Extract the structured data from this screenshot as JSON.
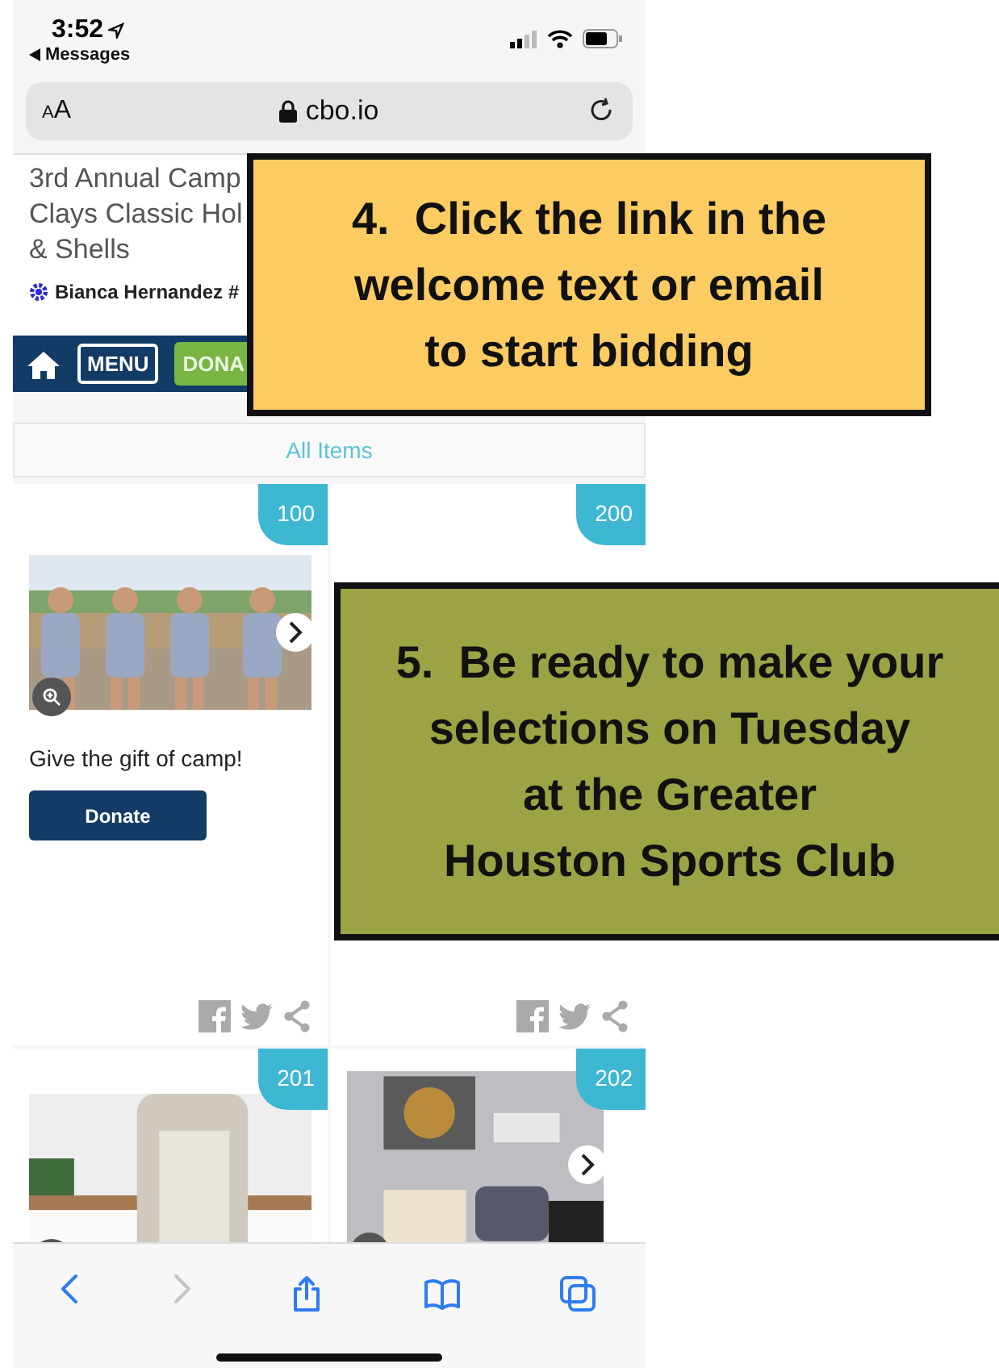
{
  "status_bar": {
    "time": "3:52",
    "back_label": "Messages"
  },
  "address_bar": {
    "text_size": "AA",
    "url": "cbo.io"
  },
  "event": {
    "title_lines": [
      "3rd Annual Camp",
      "Clays Classic Hol",
      "& Shells"
    ],
    "user": "Bianca Hernandez #"
  },
  "nav": {
    "menu": "MENU",
    "donate": "DONA"
  },
  "filter": {
    "label": "All Items"
  },
  "items": [
    {
      "number": "100",
      "kind": "camp",
      "has_next": true,
      "caption": "Give the gift of camp!",
      "button": "Donate",
      "share_icons": true
    },
    {
      "number": "200",
      "kind": "hidden",
      "has_next": false,
      "share_icons": true
    },
    {
      "number": "201",
      "kind": "kitchen",
      "has_next": false,
      "share_icons": false
    },
    {
      "number": "202",
      "kind": "jewelry",
      "has_next": true,
      "share_icons": false
    }
  ],
  "callouts": [
    {
      "color": "#fccb62",
      "lines": [
        "4.  Click the link in the",
        "welcome text or email",
        "to start bidding"
      ]
    },
    {
      "color": "#9ca345",
      "lines": [
        "5.  Be ready to make your",
        "selections on Tuesday",
        "at the Greater",
        "Houston Sports Club"
      ]
    }
  ],
  "toolbar": [
    {
      "kind": "back",
      "disabled": false
    },
    {
      "kind": "forward",
      "disabled": true
    },
    {
      "kind": "share",
      "disabled": false
    },
    {
      "kind": "bookmarks",
      "disabled": false
    },
    {
      "kind": "tabs",
      "disabled": false
    }
  ]
}
